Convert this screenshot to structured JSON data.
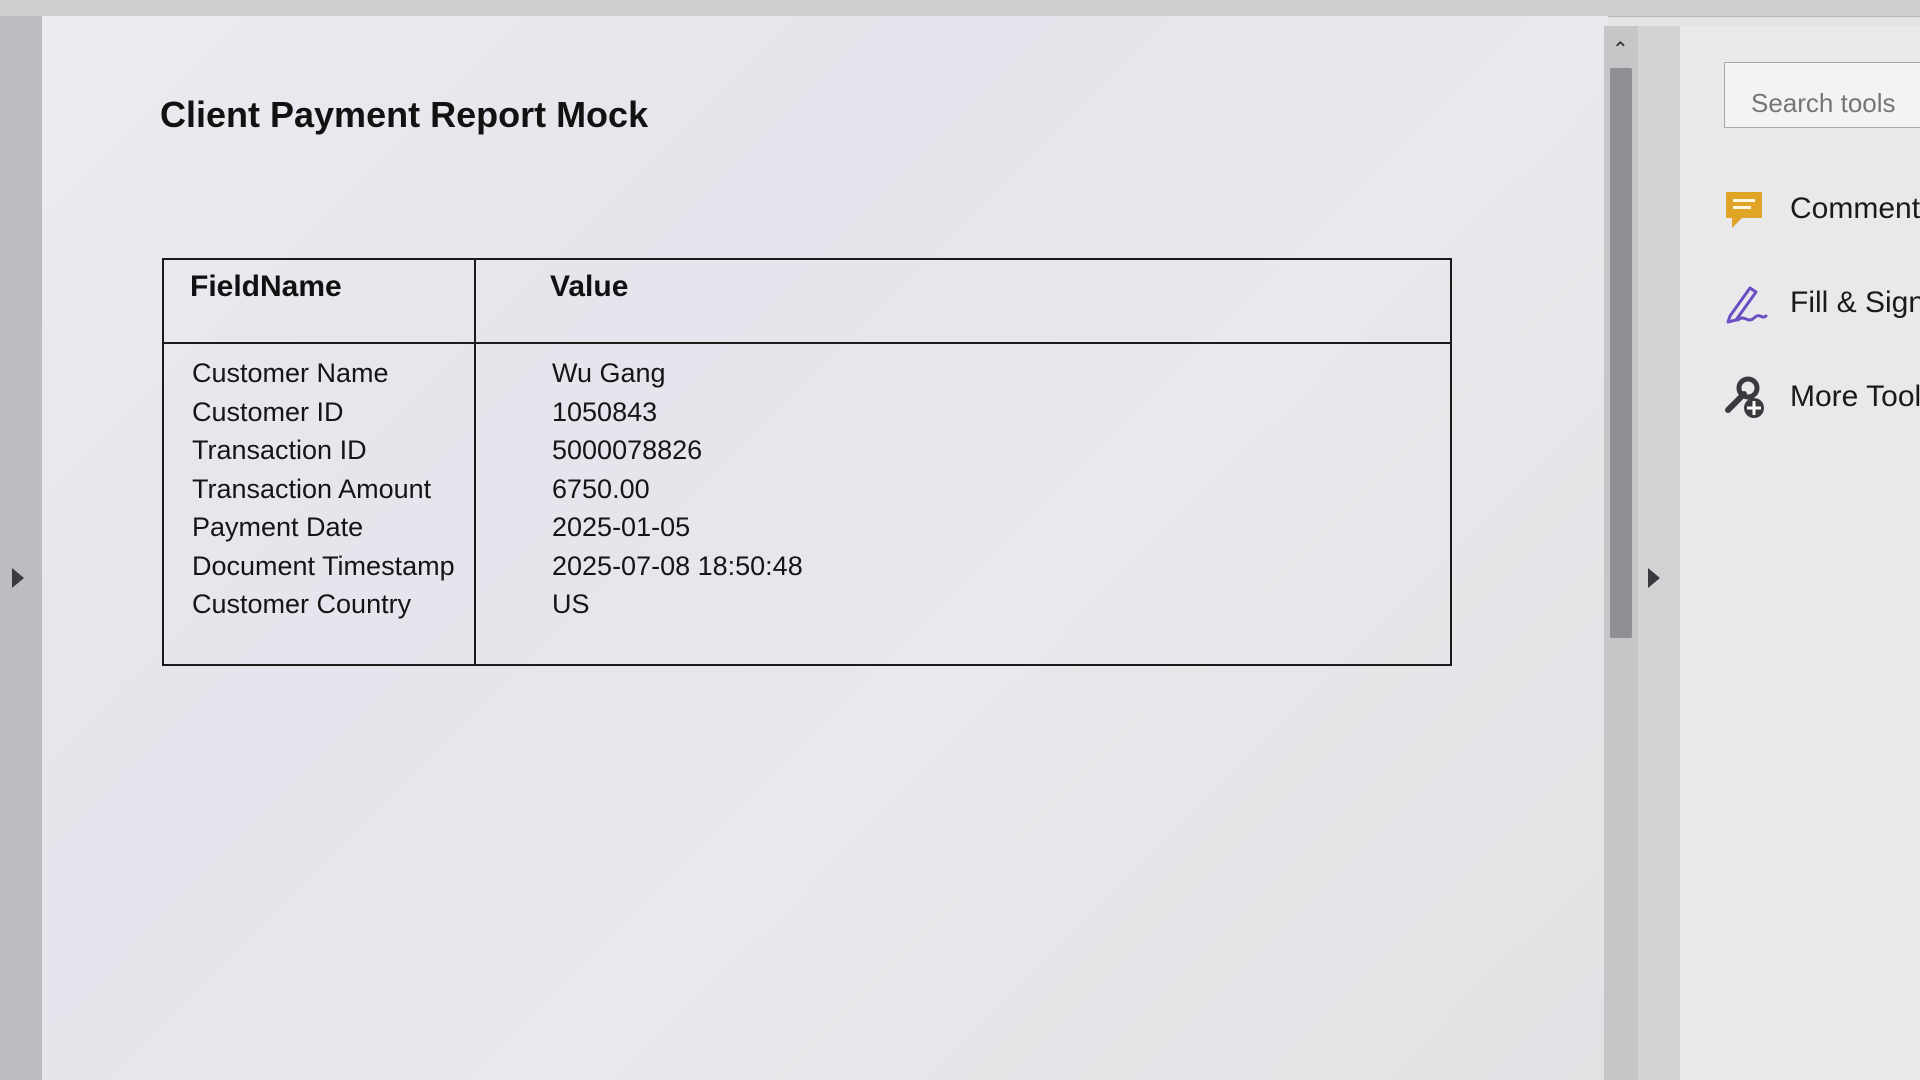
{
  "document": {
    "title": "Client Payment Report Mock",
    "table": {
      "headers": {
        "field": "FieldName",
        "value": "Value"
      },
      "rows": [
        {
          "field": "Customer Name",
          "value": "Wu Gang"
        },
        {
          "field": "Customer ID",
          "value": "1050843"
        },
        {
          "field": "Transaction ID",
          "value": "5000078826"
        },
        {
          "field": "Transaction Amount",
          "value": "6750.00"
        },
        {
          "field": "Payment Date",
          "value": "2025-01-05"
        },
        {
          "field": "Document Timestamp",
          "value": "2025-07-08 18:50:48"
        },
        {
          "field": "Customer Country",
          "value": "US"
        }
      ]
    }
  },
  "tools_pane": {
    "search": {
      "placeholder": "Search tools"
    },
    "items": [
      {
        "label": "Comment",
        "icon": "comment-icon",
        "color": "#e0a526"
      },
      {
        "label": "Fill & Sign",
        "icon": "fill-sign-icon",
        "color": "#6a4fc4"
      },
      {
        "label": "More Tools",
        "icon": "more-tools-icon",
        "color": "#3a3a3e"
      }
    ]
  },
  "colors": {
    "comment_accent": "#e0a526",
    "sign_accent": "#6a4fc4"
  }
}
